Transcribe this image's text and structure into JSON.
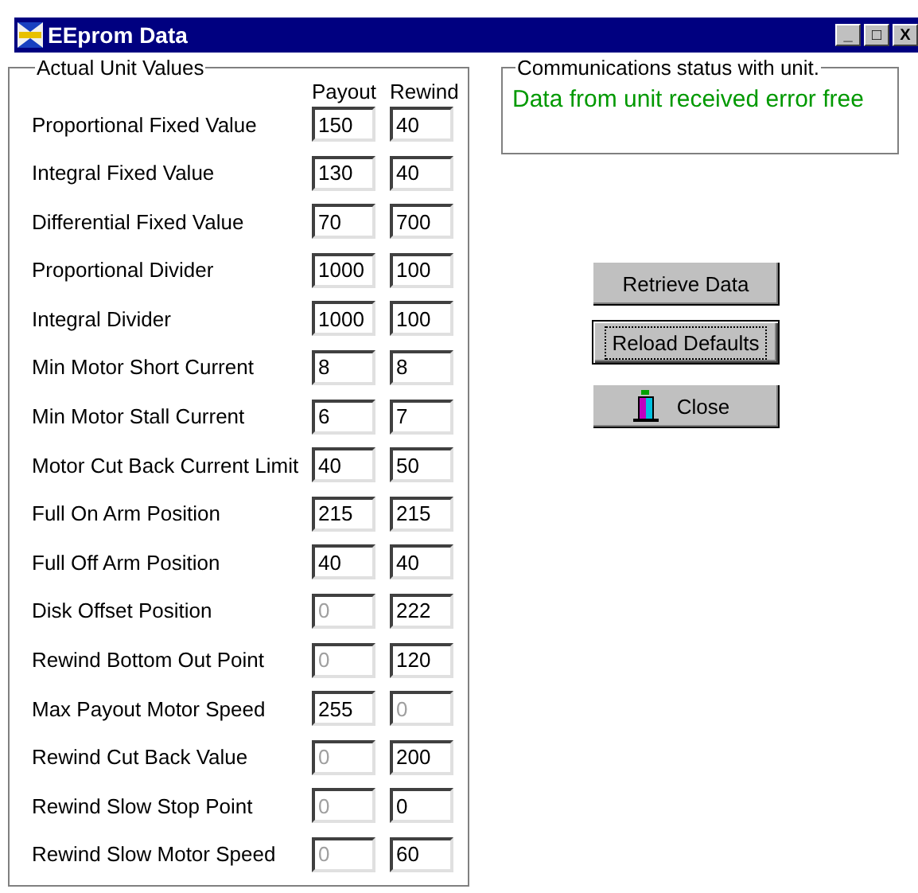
{
  "window": {
    "title": "EEprom Data",
    "controls": [
      "_",
      "□",
      "X"
    ]
  },
  "values_group": {
    "title": "Actual Unit Values",
    "columns": [
      "Payout",
      "Rewind"
    ],
    "rows": [
      {
        "label": "Proportional Fixed Value",
        "payout": {
          "value": "150",
          "disabled": false
        },
        "rewind": {
          "value": "40",
          "disabled": false
        }
      },
      {
        "label": "Integral Fixed Value",
        "payout": {
          "value": "130",
          "disabled": false
        },
        "rewind": {
          "value": "40",
          "disabled": false
        }
      },
      {
        "label": "Differential Fixed Value",
        "payout": {
          "value": "70",
          "disabled": false
        },
        "rewind": {
          "value": "700",
          "disabled": false
        }
      },
      {
        "label": "Proportional Divider",
        "payout": {
          "value": "1000",
          "disabled": false
        },
        "rewind": {
          "value": "100",
          "disabled": false
        }
      },
      {
        "label": "Integral Divider",
        "payout": {
          "value": "1000",
          "disabled": false
        },
        "rewind": {
          "value": "100",
          "disabled": false
        }
      },
      {
        "label": "Min Motor Short Current",
        "payout": {
          "value": "8",
          "disabled": false
        },
        "rewind": {
          "value": "8",
          "disabled": false
        }
      },
      {
        "label": "Min Motor Stall Current",
        "payout": {
          "value": "6",
          "disabled": false
        },
        "rewind": {
          "value": "7",
          "disabled": false
        }
      },
      {
        "label": "Motor Cut Back Current Limit",
        "payout": {
          "value": "40",
          "disabled": false
        },
        "rewind": {
          "value": "50",
          "disabled": false
        }
      },
      {
        "label": "Full On Arm Position",
        "payout": {
          "value": "215",
          "disabled": false
        },
        "rewind": {
          "value": "215",
          "disabled": false
        }
      },
      {
        "label": "Full Off Arm Position",
        "payout": {
          "value": "40",
          "disabled": false
        },
        "rewind": {
          "value": "40",
          "disabled": false
        }
      },
      {
        "label": "Disk Offset Position",
        "payout": {
          "value": "0",
          "disabled": true
        },
        "rewind": {
          "value": "222",
          "disabled": false
        }
      },
      {
        "label": "Rewind Bottom Out Point",
        "payout": {
          "value": "0",
          "disabled": true
        },
        "rewind": {
          "value": "120",
          "disabled": false
        }
      },
      {
        "label": "Max Payout Motor Speed",
        "payout": {
          "value": "255",
          "disabled": false
        },
        "rewind": {
          "value": "0",
          "disabled": true
        }
      },
      {
        "label": "Rewind Cut Back Value",
        "payout": {
          "value": "0",
          "disabled": true
        },
        "rewind": {
          "value": "200",
          "disabled": false
        }
      },
      {
        "label": "Rewind Slow Stop Point",
        "payout": {
          "value": "0",
          "disabled": true
        },
        "rewind": {
          "value": "0",
          "disabled": false
        }
      },
      {
        "label": "Rewind Slow Motor Speed",
        "payout": {
          "value": "0",
          "disabled": true
        },
        "rewind": {
          "value": "60",
          "disabled": false
        }
      }
    ]
  },
  "status_group": {
    "title": "Communications status with unit.",
    "message": "Data from unit received error free"
  },
  "buttons": [
    {
      "label": "Retrieve Data",
      "focused": false,
      "kind": "plain"
    },
    {
      "label": "Reload Defaults",
      "focused": true,
      "kind": "plain"
    },
    {
      "label": "Close",
      "focused": false,
      "kind": "icon"
    }
  ]
}
